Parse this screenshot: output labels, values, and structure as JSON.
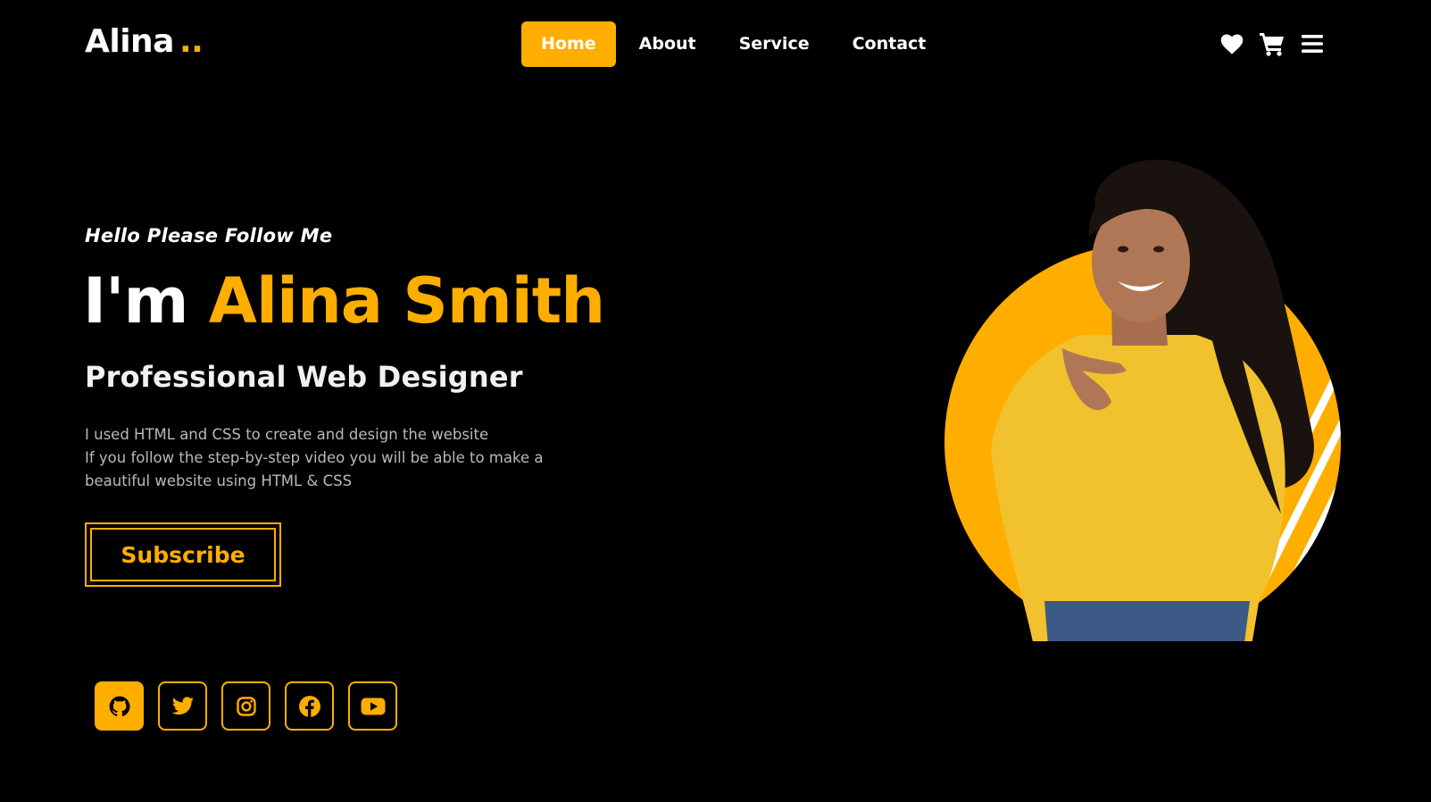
{
  "brand": {
    "name": "Alina",
    "dots": "..",
    "accent": "#ffae00"
  },
  "nav": {
    "items": [
      {
        "label": "Home",
        "active": true
      },
      {
        "label": "About",
        "active": false
      },
      {
        "label": "Service",
        "active": false
      },
      {
        "label": "Contact",
        "active": false
      }
    ]
  },
  "header_icons": [
    "heart-icon",
    "cart-icon",
    "menu-icon"
  ],
  "hero": {
    "kicker": "Hello Please Follow Me",
    "greeting": "I'm",
    "name": "Alina Smith",
    "role": "Professional Web Designer",
    "description": [
      "I used HTML and CSS to create and design the website",
      "If you follow the step-by-step video you will be able to make a",
      "beautiful website using HTML & CSS"
    ],
    "cta": "Subscribe"
  },
  "socials": [
    "github-icon",
    "twitter-icon",
    "instagram-icon",
    "facebook-icon",
    "youtube-icon"
  ]
}
